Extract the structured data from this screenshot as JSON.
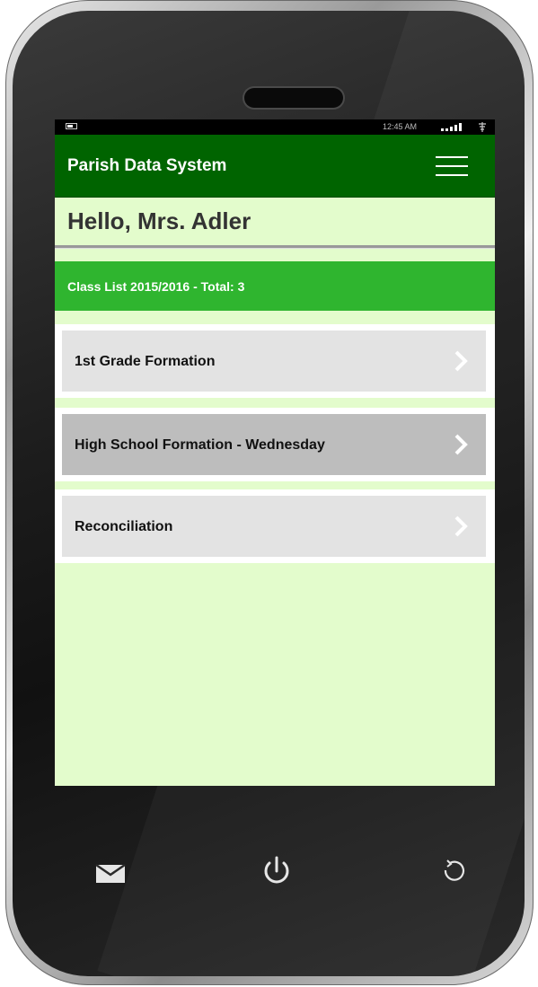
{
  "status_bar": {
    "time": "12:45 AM",
    "battery_icon": "battery-icon",
    "signal_icon": "signal-bars-icon",
    "wifi_icon": "wifi-icon"
  },
  "header": {
    "title": "Parish Data System",
    "menu_icon": "hamburger-menu-icon",
    "background_color": "#006400"
  },
  "greeting": "Hello, Mrs. Adler",
  "class_list": {
    "heading": "Class List 2015/2016 - Total: 3",
    "background_color": "#2fb52f",
    "items": [
      {
        "label": "1st Grade Formation",
        "selected": false,
        "icon": "chevron-right-icon"
      },
      {
        "label": "High School Formation - Wednesday",
        "selected": true,
        "icon": "chevron-right-icon"
      },
      {
        "label": "Reconciliation",
        "selected": false,
        "icon": "chevron-right-icon"
      }
    ]
  },
  "hardware_buttons": [
    {
      "name": "mail-icon"
    },
    {
      "name": "power-icon"
    },
    {
      "name": "refresh-icon"
    }
  ],
  "screen_background": "#e3fccc"
}
